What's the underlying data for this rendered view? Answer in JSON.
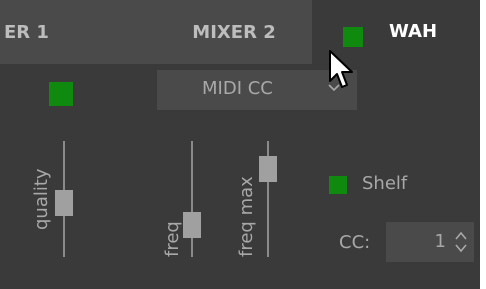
{
  "tabs": [
    {
      "label": "ER 1"
    },
    {
      "label": "MIXER 2"
    },
    {
      "label": "WAH",
      "active": true
    }
  ],
  "dropdown": {
    "value": "MIDI CC"
  },
  "sliders": [
    {
      "label": "quality",
      "level": 0.45
    },
    {
      "label": "freq",
      "level": 0.2
    },
    {
      "label": "freq max",
      "level": 0.8
    }
  ],
  "shelf": {
    "label": "Shelf"
  },
  "cc": {
    "label": "CC:",
    "value": "1"
  },
  "colors": {
    "accent_green": "#0f8a0f",
    "background": "#3a3a3a",
    "tab_inactive": "#4a4a4a",
    "text": "#a8a8a8"
  }
}
